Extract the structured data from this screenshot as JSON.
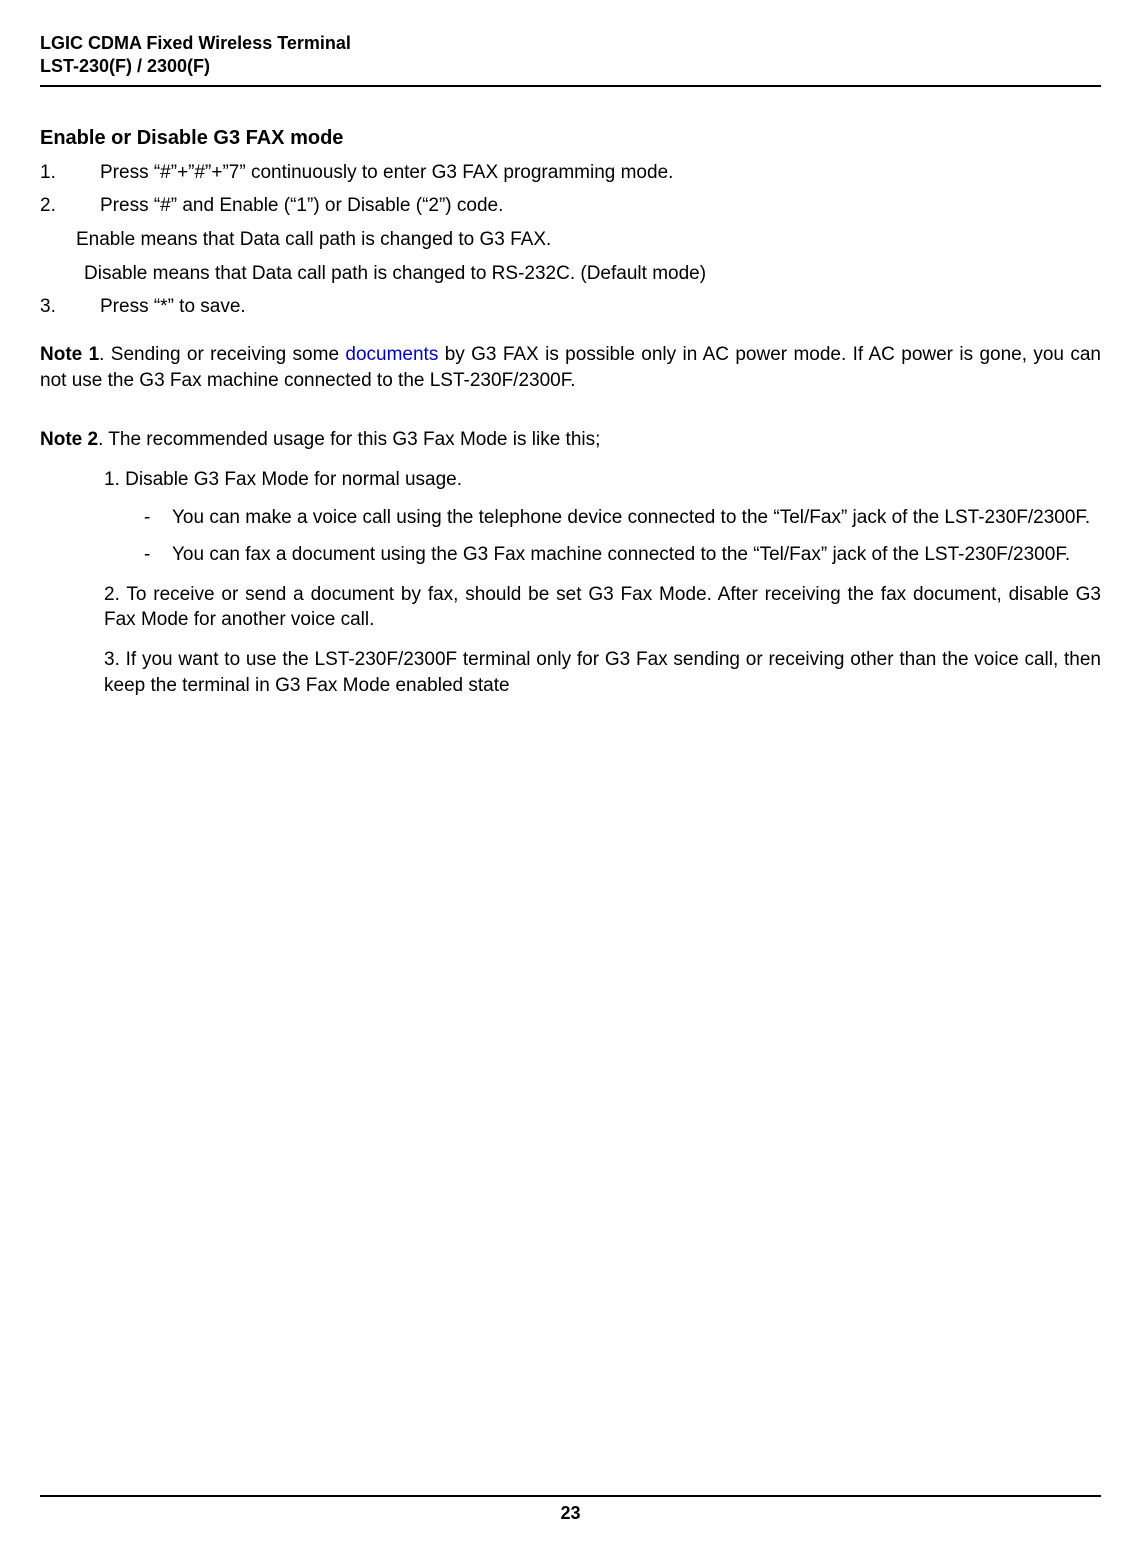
{
  "header": {
    "title": "LGIC CDMA Fixed Wireless Terminal",
    "model": "LST-230(F) / 2300(F)"
  },
  "section_title": "Enable or Disable G3 FAX mode",
  "steps": {
    "s1_num": "1.",
    "s1_text": "Press “#”+”#”+”7” continuously to enter G3 FAX programming mode.",
    "s2_num": "2.",
    "s2_text": "Press “#” and Enable (“1”) or Disable (“2”) code.",
    "enable_text": "Enable means that Data call path is changed to G3 FAX.",
    "disable_text": "Disable means that Data call path is changed to RS-232C. (Default mode)",
    "s3_num": "3.",
    "s3_text": "Press “*” to save."
  },
  "note1": {
    "label": "Note 1",
    "pre": ". Sending or receiving some ",
    "link": "documents",
    "post": " by G3 FAX is possible only in AC power mode. If AC power is gone, you can not use the G3 Fax machine connected to the LST-230F/2300F."
  },
  "note2": {
    "label": "Note 2",
    "intro": ". The recommended usage for this G3 Fax Mode is like this;",
    "item1": "1. Disable G3 Fax Mode for normal usage.",
    "dash1": "You can make a voice call using the telephone device connected to the “Tel/Fax” jack of the LST-230F/2300F.",
    "dash2": "You can fax a document using the G3 Fax machine connected to the “Tel/Fax” jack of the LST-230F/2300F.",
    "item2": "2. To receive or send a document by fax, should be set G3 Fax Mode. After receiving the fax document, disable G3 Fax Mode for another voice call.",
    "item3": "3. If you want to use the LST-230F/2300F terminal only for G3 Fax sending or receiving other than the voice call, then keep the terminal in G3 Fax Mode enabled state"
  },
  "footer": {
    "page_number": "23"
  }
}
